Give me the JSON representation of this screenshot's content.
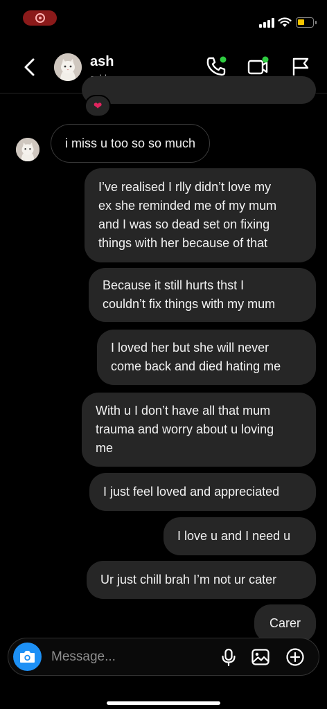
{
  "contact": {
    "name": "ash",
    "username": "ashlxxn"
  },
  "reaction": "❤",
  "messages": [
    {
      "from": "them",
      "text": "i miss u too so so much"
    },
    {
      "from": "me",
      "lines": [
        "I’ve realised I rlly didn’t love my",
        "ex she reminded me of my mum",
        "and I was so dead set on fixing",
        "things with her because of that"
      ]
    },
    {
      "from": "me",
      "lines": [
        "Because it still hurts thst I",
        "couldn’t fix things with my mum"
      ]
    },
    {
      "from": "me",
      "lines": [
        "I loved her but she will never",
        "come back and died hating me"
      ]
    },
    {
      "from": "me",
      "lines": [
        "With u I don’t have all that mum",
        "trauma and worry about u loving",
        "me"
      ]
    },
    {
      "from": "me",
      "lines": [
        "I just feel loved and appreciated"
      ]
    },
    {
      "from": "me",
      "lines": [
        "I love u and I need u"
      ]
    },
    {
      "from": "me",
      "lines": [
        "Ur just chill brah I’m not ur cater"
      ]
    },
    {
      "from": "me",
      "lines": [
        "Carer"
      ]
    }
  ],
  "composer": {
    "placeholder": "Message..."
  },
  "icons": {
    "back": "chevron-left-icon",
    "call": "phone-icon",
    "video": "video-icon",
    "report": "flag-icon",
    "camera": "camera-icon",
    "mic": "microphone-icon",
    "gallery": "image-icon",
    "add": "plus-circle-icon"
  },
  "colors": {
    "background": "#000000",
    "bubble": "#262626",
    "accent": "#1d90f5",
    "online": "#2ecc40",
    "battery": "#f5c400",
    "record": "#8b1a1a"
  }
}
